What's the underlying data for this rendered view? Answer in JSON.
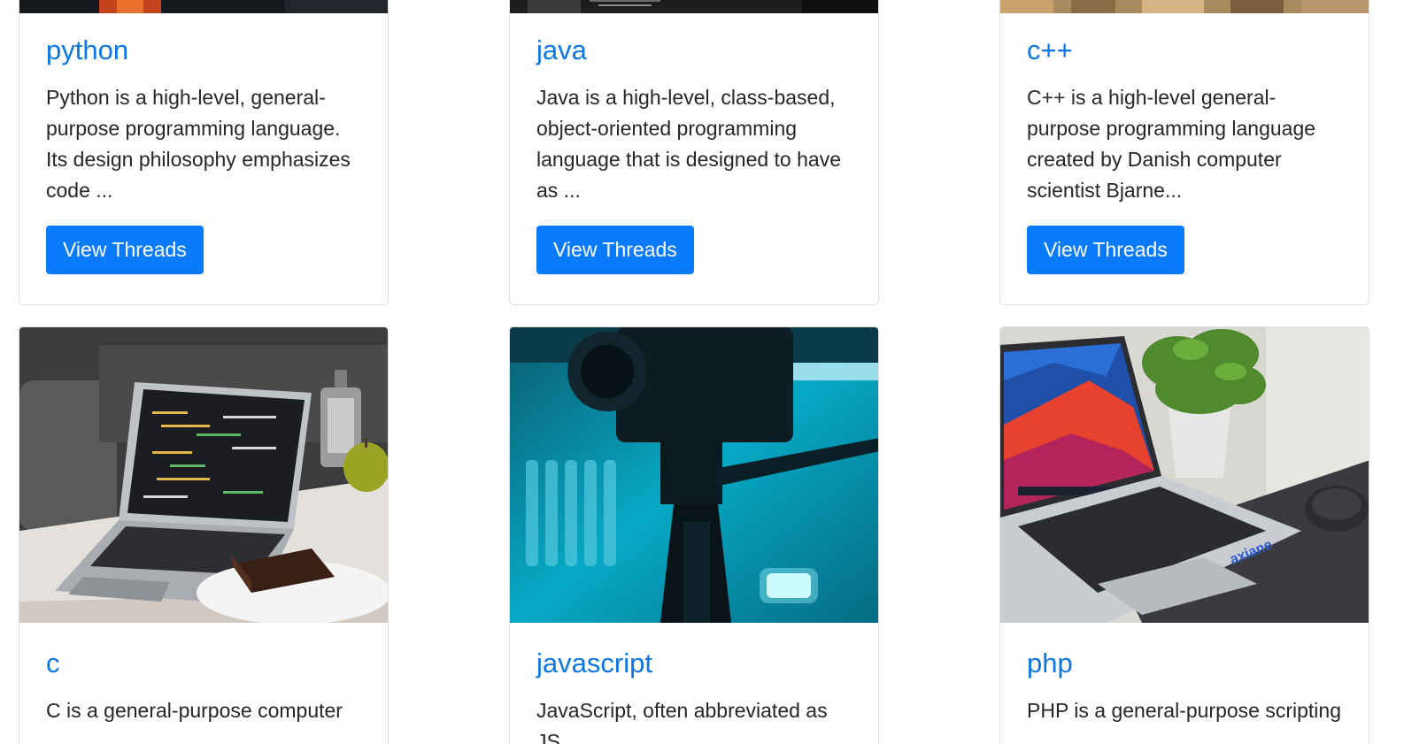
{
  "cards": [
    {
      "title": "python",
      "description": "Python is a high-level, general-purpose programming language. Its design philosophy emphasizes code ...",
      "button_label": "View Threads"
    },
    {
      "title": "java",
      "description": "Java is a high-level, class-based, object-oriented programming language that is designed to have as ...",
      "button_label": "View Threads"
    },
    {
      "title": "c++",
      "description": "C++ is a high-level general-purpose programming language created by Danish computer scientist Bjarne...",
      "button_label": "View Threads"
    },
    {
      "title": "c",
      "description": "C is a general-purpose computer"
    },
    {
      "title": "javascript",
      "description": "JavaScript, often abbreviated as JS,"
    },
    {
      "title": "php",
      "description": "PHP is a general-purpose scripting",
      "laptop_brand": "axiane"
    }
  ],
  "colors": {
    "link": "#0b76e6",
    "button": "#0a7bff",
    "border": "#dfdfdf"
  }
}
